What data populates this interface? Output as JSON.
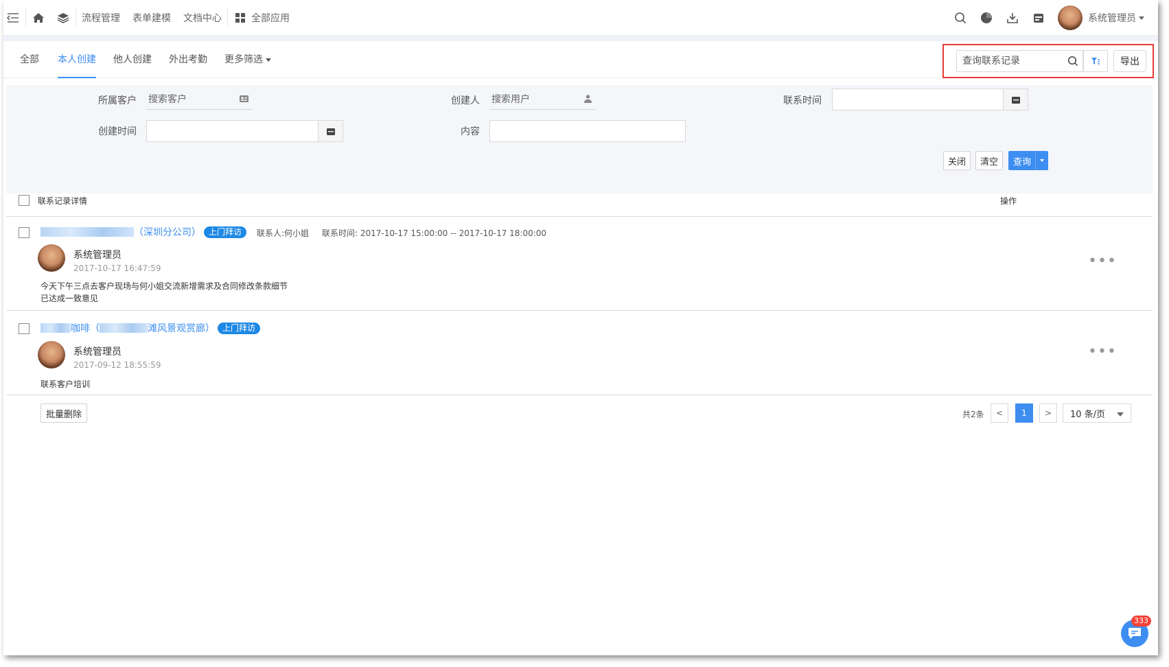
{
  "nav": {
    "links": [
      "流程管理",
      "表单建模",
      "文档中心"
    ],
    "all_apps": "全部应用",
    "user_name": "系统管理员"
  },
  "tabs": [
    "全部",
    "本人创建",
    "他人创建",
    "外出考勤",
    "更多筛选"
  ],
  "active_tab": "本人创建",
  "toolbar": {
    "search_placeholder": "查询联系记录",
    "export_label": "导出"
  },
  "filters": {
    "customer_label": "所属客户",
    "customer_placeholder": "搜索客户",
    "creator_label": "创建人",
    "creator_placeholder": "搜索用户",
    "contact_time_label": "联系时间",
    "created_time_label": "创建时间",
    "content_label": "内容",
    "close_label": "关闭",
    "clear_label": "清空",
    "query_label": "查询"
  },
  "list": {
    "header_detail": "联系记录详情",
    "header_action": "操作",
    "records": [
      {
        "title_suffix": "（深圳分公司）",
        "tag": "上门拜访",
        "contact_person": "联系人:何小姐",
        "contact_time": "联系时间: 2017-10-17 15:00:00 -- 2017-10-17 18:00:00",
        "author": "系统管理员",
        "created": "2017-10-17 16:47:59",
        "content_line1": "今天下午三点去客户现场与何小姐交流新增需求及合同修改条款细节",
        "content_line2": "已达成一致意见"
      },
      {
        "title_mid1": "咖啡（",
        "title_mid2": "滩风景观赏廊）",
        "tag": "上门拜访",
        "author": "系统管理员",
        "created": "2017-09-12 18:55:59",
        "content_line1": "联系客户培训"
      }
    ]
  },
  "footer": {
    "batch_delete": "批量删除",
    "total": "共2条",
    "prev": "<",
    "page": "1",
    "next": ">",
    "page_size": "10 条/页"
  },
  "chat": {
    "badge": "333"
  },
  "colors": {
    "accent": "#3d8ef0",
    "highlight_border": "#e53935",
    "tag": "#1e88e5"
  }
}
